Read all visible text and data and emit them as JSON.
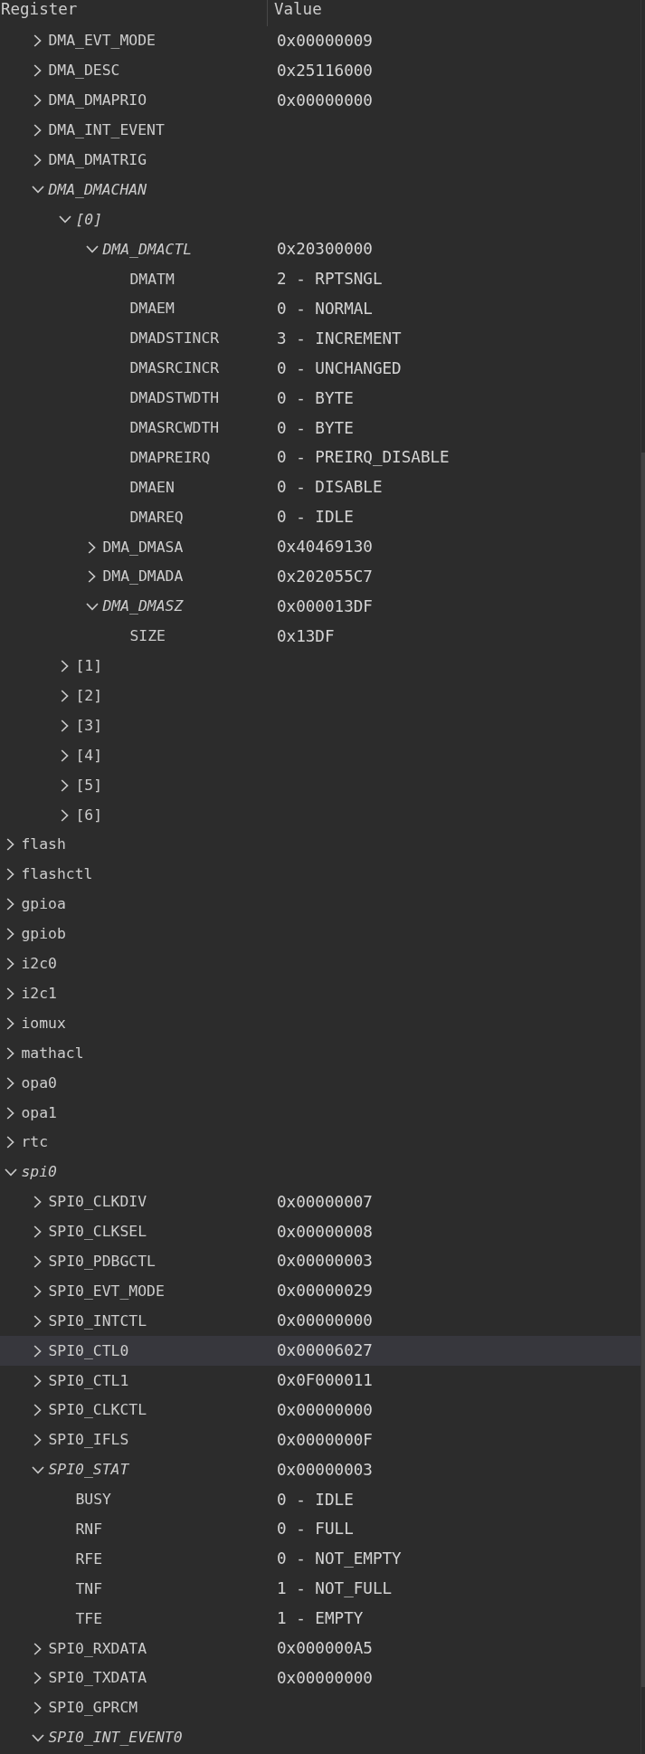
{
  "header": {
    "columns": [
      "Register",
      "Value"
    ]
  },
  "tree": {
    "items": [
      {
        "children": [
          {
            "label": "DMA_EVT_MODE",
            "value": "0x00000009",
            "expanded": false,
            "selected": false
          },
          {
            "label": "DMA_DESC",
            "value": "0x25116000",
            "expanded": false,
            "selected": false
          },
          {
            "label": "DMA_DMAPRIO",
            "value": "0x00000000",
            "expanded": false,
            "selected": false
          },
          {
            "label": "DMA_INT_EVENT",
            "expanded": false,
            "selected": false
          },
          {
            "label": "DMA_DMATRIG",
            "expanded": false,
            "selected": false
          },
          {
            "label": "DMA_DMACHAN",
            "expanded": true,
            "selected": false,
            "children": [
              {
                "label": "[0]",
                "expanded": true,
                "selected": false,
                "children": [
                  {
                    "label": "DMA_DMACTL",
                    "value": "0x20300000",
                    "expanded": true,
                    "selected": false,
                    "children": [
                      {
                        "label": "DMATM",
                        "value": "2 - RPTSNGL",
                        "selected": false
                      },
                      {
                        "label": "DMAEM",
                        "value": "0 - NORMAL",
                        "selected": false
                      },
                      {
                        "label": "DMADSTINCR",
                        "value": "3 - INCREMENT",
                        "selected": false
                      },
                      {
                        "label": "DMASRCINCR",
                        "value": "0 - UNCHANGED",
                        "selected": false
                      },
                      {
                        "label": "DMADSTWDTH",
                        "value": "0 - BYTE",
                        "selected": false
                      },
                      {
                        "label": "DMASRCWDTH",
                        "value": "0 - BYTE",
                        "selected": false
                      },
                      {
                        "label": "DMAPREIRQ",
                        "value": "0 - PREIRQ_DISABLE",
                        "selected": false
                      },
                      {
                        "label": "DMAEN",
                        "value": "0 - DISABLE",
                        "selected": false
                      },
                      {
                        "label": "DMAREQ",
                        "value": "0 - IDLE",
                        "selected": false
                      }
                    ]
                  },
                  {
                    "label": "DMA_DMASA",
                    "value": "0x40469130",
                    "expanded": false,
                    "selected": false
                  },
                  {
                    "label": "DMA_DMADA",
                    "value": "0x202055C7",
                    "expanded": false,
                    "selected": false
                  },
                  {
                    "label": "DMA_DMASZ",
                    "value": "0x000013DF",
                    "expanded": true,
                    "selected": false,
                    "children": [
                      {
                        "label": "SIZE",
                        "value": "0x13DF",
                        "selected": false
                      }
                    ]
                  }
                ]
              },
              {
                "label": "[1]",
                "expanded": false,
                "selected": false
              },
              {
                "label": "[2]",
                "expanded": false,
                "selected": false
              },
              {
                "label": "[3]",
                "expanded": false,
                "selected": false
              },
              {
                "label": "[4]",
                "expanded": false,
                "selected": false
              },
              {
                "label": "[5]",
                "expanded": false,
                "selected": false
              },
              {
                "label": "[6]",
                "expanded": false,
                "selected": false
              }
            ]
          }
        ]
      },
      {
        "label": "flash",
        "expanded": false,
        "selected": false
      },
      {
        "label": "flashctl",
        "expanded": false,
        "selected": false
      },
      {
        "label": "gpioa",
        "expanded": false,
        "selected": false
      },
      {
        "label": "gpiob",
        "expanded": false,
        "selected": false
      },
      {
        "label": "i2c0",
        "expanded": false,
        "selected": false
      },
      {
        "label": "i2c1",
        "expanded": false,
        "selected": false
      },
      {
        "label": "iomux",
        "expanded": false,
        "selected": false
      },
      {
        "label": "mathacl",
        "expanded": false,
        "selected": false
      },
      {
        "label": "opa0",
        "expanded": false,
        "selected": false
      },
      {
        "label": "opa1",
        "expanded": false,
        "selected": false
      },
      {
        "label": "rtc",
        "expanded": false,
        "selected": false
      },
      {
        "label": "spi0",
        "expanded": true,
        "selected": false,
        "children": [
          {
            "label": "SPI0_CLKDIV",
            "value": "0x00000007",
            "expanded": false,
            "selected": false
          },
          {
            "label": "SPI0_CLKSEL",
            "value": "0x00000008",
            "expanded": false,
            "selected": false
          },
          {
            "label": "SPI0_PDBGCTL",
            "value": "0x00000003",
            "expanded": false,
            "selected": false
          },
          {
            "label": "SPI0_EVT_MODE",
            "value": "0x00000029",
            "expanded": false,
            "selected": false
          },
          {
            "label": "SPI0_INTCTL",
            "value": "0x00000000",
            "expanded": false,
            "selected": false
          },
          {
            "label": "SPI0_CTL0",
            "value": "0x00006027",
            "expanded": false,
            "selected": true
          },
          {
            "label": "SPI0_CTL1",
            "value": "0x0F000011",
            "expanded": false,
            "selected": false
          },
          {
            "label": "SPI0_CLKCTL",
            "value": "0x00000000",
            "expanded": false,
            "selected": false
          },
          {
            "label": "SPI0_IFLS",
            "value": "0x0000000F",
            "expanded": false,
            "selected": false
          },
          {
            "label": "SPI0_STAT",
            "value": "0x00000003",
            "expanded": true,
            "selected": false,
            "children": [
              {
                "label": "BUSY",
                "value": "0 - IDLE",
                "selected": false
              },
              {
                "label": "RNF",
                "value": "0 - FULL",
                "selected": false
              },
              {
                "label": "RFE",
                "value": "0 - NOT_EMPTY",
                "selected": false
              },
              {
                "label": "TNF",
                "value": "1 - NOT_FULL",
                "selected": false
              },
              {
                "label": "TFE",
                "value": "1 - EMPTY",
                "selected": false
              }
            ]
          },
          {
            "label": "SPI0_RXDATA",
            "value": "0x000000A5",
            "expanded": false,
            "selected": false
          },
          {
            "label": "SPI0_TXDATA",
            "value": "0x00000000",
            "expanded": false,
            "selected": false
          },
          {
            "label": "SPI0_GPRCM",
            "expanded": false,
            "selected": false
          },
          {
            "label": "SPI0_INT_EVENT0",
            "expanded": true,
            "selected": false
          }
        ]
      }
    ]
  }
}
